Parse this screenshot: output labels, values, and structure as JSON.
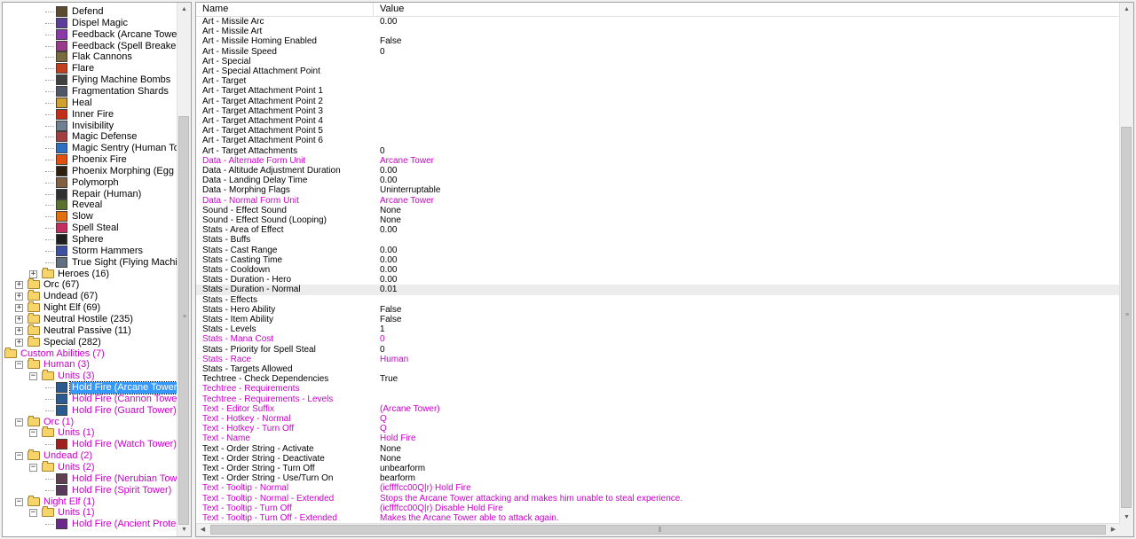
{
  "tree": [
    {
      "label": "Defend",
      "level": 3,
      "type": "item",
      "icon": "#5a4a30"
    },
    {
      "label": "Dispel Magic",
      "level": 3,
      "type": "item",
      "icon": "#5d3d9a"
    },
    {
      "label": "Feedback (Arcane Tower)",
      "level": 3,
      "type": "item",
      "icon": "#8a3aa8"
    },
    {
      "label": "Feedback (Spell Breaker)",
      "level": 3,
      "type": "item",
      "icon": "#9a3a8a"
    },
    {
      "label": "Flak Cannons",
      "level": 3,
      "type": "item",
      "icon": "#7a6a40"
    },
    {
      "label": "Flare",
      "level": 3,
      "type": "item",
      "icon": "#c04020"
    },
    {
      "label": "Flying Machine Bombs",
      "level": 3,
      "type": "item",
      "icon": "#404040"
    },
    {
      "label": "Fragmentation Shards",
      "level": 3,
      "type": "item",
      "icon": "#505868"
    },
    {
      "label": "Heal",
      "level": 3,
      "type": "item",
      "icon": "#d0a030"
    },
    {
      "label": "Inner Fire",
      "level": 3,
      "type": "item",
      "icon": "#c03018"
    },
    {
      "label": "Invisibility",
      "level": 3,
      "type": "item",
      "icon": "#708090"
    },
    {
      "label": "Magic Defense",
      "level": 3,
      "type": "item",
      "icon": "#a04040"
    },
    {
      "label": "Magic Sentry (Human Towers)",
      "level": 3,
      "type": "item",
      "icon": "#3070c0"
    },
    {
      "label": "Phoenix Fire",
      "level": 3,
      "type": "item",
      "icon": "#e05010"
    },
    {
      "label": "Phoenix Morphing (Egg Related)",
      "level": 3,
      "type": "item",
      "icon": "#302010"
    },
    {
      "label": "Polymorph",
      "level": 3,
      "type": "item",
      "icon": "#806040"
    },
    {
      "label": "Repair (Human)",
      "level": 3,
      "type": "item",
      "icon": "#303030"
    },
    {
      "label": "Reveal",
      "level": 3,
      "type": "item",
      "icon": "#5a7030"
    },
    {
      "label": "Slow",
      "level": 3,
      "type": "item",
      "icon": "#e07010"
    },
    {
      "label": "Spell Steal",
      "level": 3,
      "type": "item",
      "icon": "#c03060"
    },
    {
      "label": "Sphere",
      "level": 3,
      "type": "item",
      "icon": "#202020"
    },
    {
      "label": "Storm Hammers",
      "level": 3,
      "type": "item",
      "icon": "#4050a0"
    },
    {
      "label": "True Sight (Flying Machine)",
      "level": 3,
      "type": "item",
      "icon": "#607080"
    },
    {
      "label": "Heroes (16)",
      "level": 2,
      "type": "folder",
      "expander": "+"
    },
    {
      "label": "Orc (67)",
      "level": 1,
      "type": "folder",
      "expander": "+"
    },
    {
      "label": "Undead (67)",
      "level": 1,
      "type": "folder",
      "expander": "+"
    },
    {
      "label": "Night Elf (69)",
      "level": 1,
      "type": "folder",
      "expander": "+"
    },
    {
      "label": "Neutral Hostile (235)",
      "level": 1,
      "type": "folder",
      "expander": "+"
    },
    {
      "label": "Neutral Passive (11)",
      "level": 1,
      "type": "folder",
      "expander": "+"
    },
    {
      "label": "Special (282)",
      "level": 1,
      "type": "folder",
      "expander": "+"
    },
    {
      "label": "Custom Abilities (7)",
      "level": 0,
      "type": "folder",
      "modified": true
    },
    {
      "label": "Human (3)",
      "level": 1,
      "type": "folder",
      "expander": "−",
      "modified": true
    },
    {
      "label": "Units (3)",
      "level": 2,
      "type": "folder",
      "expander": "−",
      "modified": true
    },
    {
      "label": "Hold Fire (Arcane Tower)",
      "level": 3,
      "type": "item",
      "icon": "#2a5a90",
      "selected": true
    },
    {
      "label": "Hold Fire (Cannon Tower)",
      "level": 3,
      "type": "item",
      "icon": "#2a5a90",
      "modified": true
    },
    {
      "label": "Hold Fire (Guard Tower)",
      "level": 3,
      "type": "item",
      "icon": "#2a5a90",
      "modified": true
    },
    {
      "label": "Orc (1)",
      "level": 1,
      "type": "folder",
      "expander": "−",
      "modified": true
    },
    {
      "label": "Units (1)",
      "level": 2,
      "type": "folder",
      "expander": "−",
      "modified": true
    },
    {
      "label": "Hold Fire (Watch Tower)",
      "level": 3,
      "type": "item",
      "icon": "#a02020",
      "modified": true
    },
    {
      "label": "Undead (2)",
      "level": 1,
      "type": "folder",
      "expander": "−",
      "modified": true
    },
    {
      "label": "Units (2)",
      "level": 2,
      "type": "folder",
      "expander": "−",
      "modified": true
    },
    {
      "label": "Hold Fire (Nerubian Tower)",
      "level": 3,
      "type": "item",
      "icon": "#604050",
      "modified": true
    },
    {
      "label": "Hold Fire (Spirit Tower)",
      "level": 3,
      "type": "item",
      "icon": "#5a3a5a",
      "modified": true
    },
    {
      "label": "Night Elf (1)",
      "level": 1,
      "type": "folder",
      "expander": "−",
      "modified": true
    },
    {
      "label": "Units (1)",
      "level": 2,
      "type": "folder",
      "expander": "−",
      "modified": true
    },
    {
      "label": "Hold Fire (Ancient Protector)",
      "level": 3,
      "type": "item",
      "icon": "#6a2a8a",
      "modified": true
    }
  ],
  "grid": {
    "columns": {
      "name": "Name",
      "value": "Value"
    },
    "rows": [
      {
        "name": "Art - Missile Arc",
        "value": "0.00"
      },
      {
        "name": "Art - Missile Art",
        "value": ""
      },
      {
        "name": "Art - Missile Homing Enabled",
        "value": "False"
      },
      {
        "name": "Art - Missile Speed",
        "value": "0"
      },
      {
        "name": "Art - Special",
        "value": ""
      },
      {
        "name": "Art - Special Attachment Point",
        "value": ""
      },
      {
        "name": "Art - Target",
        "value": ""
      },
      {
        "name": "Art - Target Attachment Point 1",
        "value": ""
      },
      {
        "name": "Art - Target Attachment Point 2",
        "value": ""
      },
      {
        "name": "Art - Target Attachment Point 3",
        "value": ""
      },
      {
        "name": "Art - Target Attachment Point 4",
        "value": ""
      },
      {
        "name": "Art - Target Attachment Point 5",
        "value": ""
      },
      {
        "name": "Art - Target Attachment Point 6",
        "value": ""
      },
      {
        "name": "Art - Target Attachments",
        "value": "0"
      },
      {
        "name": "Data - Alternate Form Unit",
        "value": "Arcane Tower",
        "modified": true
      },
      {
        "name": "Data - Altitude Adjustment Duration",
        "value": "0.00"
      },
      {
        "name": "Data - Landing Delay Time",
        "value": "0.00"
      },
      {
        "name": "Data - Morphing Flags",
        "value": "Uninterruptable"
      },
      {
        "name": "Data - Normal Form Unit",
        "value": "Arcane Tower",
        "modified": true
      },
      {
        "name": "Sound - Effect Sound",
        "value": "None"
      },
      {
        "name": "Sound - Effect Sound (Looping)",
        "value": "None"
      },
      {
        "name": "Stats - Area of Effect",
        "value": "0.00"
      },
      {
        "name": "Stats - Buffs",
        "value": ""
      },
      {
        "name": "Stats - Cast Range",
        "value": "0.00"
      },
      {
        "name": "Stats - Casting Time",
        "value": "0.00"
      },
      {
        "name": "Stats - Cooldown",
        "value": "0.00"
      },
      {
        "name": "Stats - Duration - Hero",
        "value": "0.00"
      },
      {
        "name": "Stats - Duration - Normal",
        "value": "0.01",
        "highlighted": true
      },
      {
        "name": "Stats - Effects",
        "value": ""
      },
      {
        "name": "Stats - Hero Ability",
        "value": "False"
      },
      {
        "name": "Stats - Item Ability",
        "value": "False"
      },
      {
        "name": "Stats - Levels",
        "value": "1"
      },
      {
        "name": "Stats - Mana Cost",
        "value": "0",
        "modified": true
      },
      {
        "name": "Stats - Priority for Spell Steal",
        "value": "0"
      },
      {
        "name": "Stats - Race",
        "value": "Human",
        "modified": true
      },
      {
        "name": "Stats - Targets Allowed",
        "value": ""
      },
      {
        "name": "Techtree - Check Dependencies",
        "value": "True"
      },
      {
        "name": "Techtree - Requirements",
        "value": "",
        "modified": true
      },
      {
        "name": "Techtree - Requirements - Levels",
        "value": "",
        "modified": true
      },
      {
        "name": "Text - Editor Suffix",
        "value": "(Arcane Tower)",
        "modified": true
      },
      {
        "name": "Text - Hotkey - Normal",
        "value": "Q",
        "modified": true
      },
      {
        "name": "Text - Hotkey - Turn Off",
        "value": "Q",
        "modified": true
      },
      {
        "name": "Text - Name",
        "value": "Hold Fire",
        "modified": true
      },
      {
        "name": "Text - Order String - Activate",
        "value": "None"
      },
      {
        "name": "Text - Order String - Deactivate",
        "value": "None"
      },
      {
        "name": "Text - Order String - Turn Off",
        "value": "unbearform"
      },
      {
        "name": "Text - Order String - Use/Turn On",
        "value": "bearform"
      },
      {
        "name": "Text - Tooltip - Normal",
        "value": "(icffffcc00Q|r) Hold Fire",
        "modified": true
      },
      {
        "name": "Text - Tooltip - Normal - Extended",
        "value": "Stops the Arcane Tower attacking and makes him unable to steal experience.",
        "modified": true
      },
      {
        "name": "Text - Tooltip - Turn Off",
        "value": "(icffffcc00Q|r) Disable Hold Fire",
        "modified": true
      },
      {
        "name": "Text - Tooltip - Turn Off - Extended",
        "value": "Makes the Arcane Tower able to attack again.",
        "modified": true
      }
    ]
  }
}
